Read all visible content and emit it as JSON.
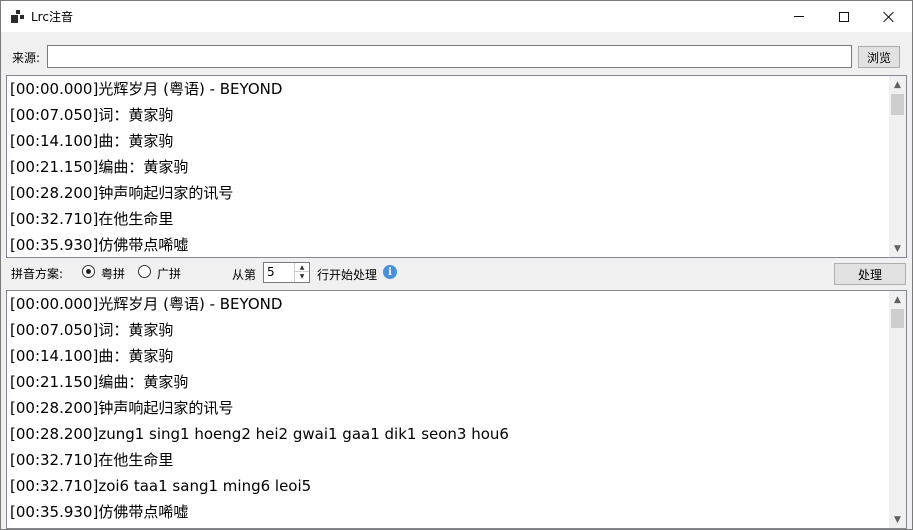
{
  "window": {
    "title": "Lrc注音"
  },
  "source": {
    "label": "来源:",
    "value": "",
    "browse_label": "浏览"
  },
  "input_lyrics": {
    "lines": [
      "[00:00.000]光辉岁月 (粤语) - BEYOND",
      "[00:07.050]词：黄家驹",
      "[00:14.100]曲：黄家驹",
      "[00:21.150]编曲：黄家驹",
      "[00:28.200]钟声响起归家的讯号",
      "[00:32.710]在他生命里",
      "[00:35.930]仿佛带点唏嘘"
    ]
  },
  "options": {
    "scheme_label": "拼音方案:",
    "schemes": [
      {
        "label": "粤拼",
        "checked": true
      },
      {
        "label": "广拼",
        "checked": false
      }
    ],
    "from_label": "从第",
    "start_line": "5",
    "after_label": "行开始处理",
    "info_icon": "info-icon",
    "process_label": "处理"
  },
  "output_lyrics": {
    "lines": [
      "[00:00.000]光辉岁月 (粤语) - BEYOND",
      "[00:07.050]词：黄家驹",
      "[00:14.100]曲：黄家驹",
      "[00:21.150]编曲：黄家驹",
      "[00:28.200]钟声响起归家的讯号",
      "[00:28.200]zung1 sing1 hoeng2 hei2 gwai1 gaa1 dik1 seon3 hou6",
      "[00:32.710]在他生命里",
      "[00:32.710]zoi6 taa1 sang1 ming6 leoi5",
      "[00:35.930]仿佛带点唏嘘"
    ]
  }
}
